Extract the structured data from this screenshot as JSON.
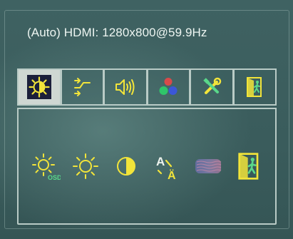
{
  "header": {
    "input_status": "(Auto) HDMI: 1280x800@59.9Hz"
  },
  "tabs": [
    {
      "icon": "brightness-contrast-icon",
      "active": true
    },
    {
      "icon": "input-source-icon",
      "active": false
    },
    {
      "icon": "audio-icon",
      "active": false
    },
    {
      "icon": "color-icon",
      "active": false
    },
    {
      "icon": "settings-tools-icon",
      "active": false
    },
    {
      "icon": "exit-icon",
      "active": false
    }
  ],
  "submenu": [
    {
      "icon": "osd-brightness-icon",
      "overlay_text": "OSD"
    },
    {
      "icon": "brightness-icon"
    },
    {
      "icon": "contrast-icon"
    },
    {
      "icon": "sharpness-text-icon",
      "overlay_text": "A"
    },
    {
      "icon": "noise-reduction-icon"
    },
    {
      "icon": "exit-icon"
    }
  ],
  "colors": {
    "icon_yellow": "#f2e43a",
    "icon_green": "#59d88a",
    "tab_border": "#b9cbc6",
    "active_tab_bg": "#cfd7d2",
    "active_icon_bg": "#1b1f3a"
  }
}
